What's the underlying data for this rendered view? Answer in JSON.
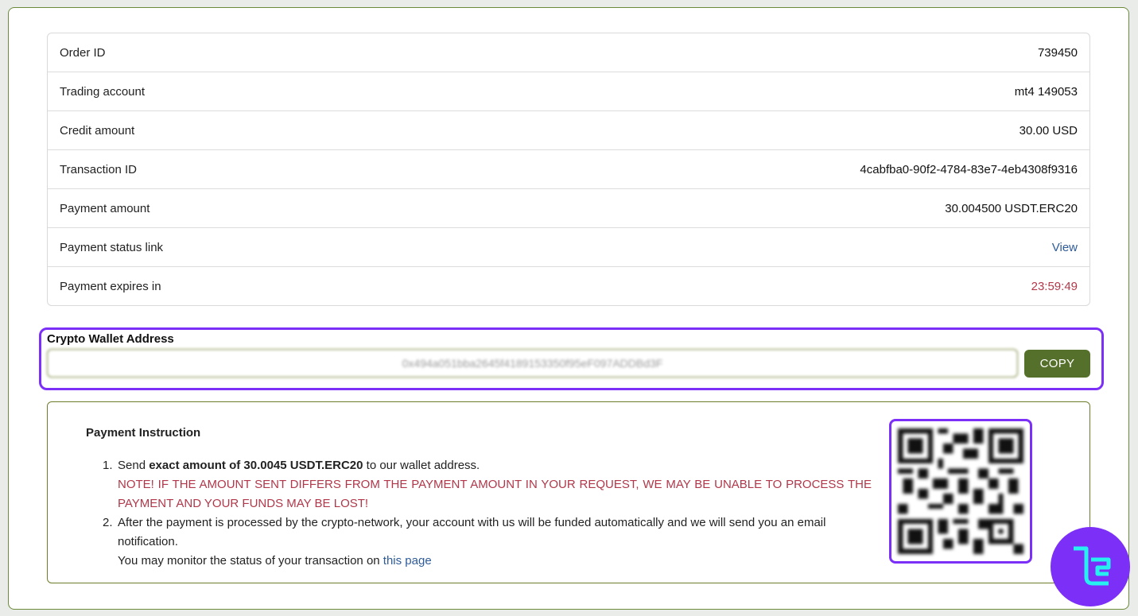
{
  "details": [
    {
      "label": "Order ID",
      "value": "739450"
    },
    {
      "label": "Trading account",
      "value": "mt4 149053"
    },
    {
      "label": "Credit amount",
      "value": "30.00 USD"
    },
    {
      "label": "Transaction ID",
      "value": "4cabfba0-90f2-4784-83e7-4eb4308f9316"
    },
    {
      "label": "Payment amount",
      "value": "30.004500 USDT.ERC20"
    },
    {
      "label": "Payment status link",
      "value": "View"
    },
    {
      "label": "Payment expires in",
      "value": "23:59:49"
    }
  ],
  "wallet": {
    "title": "Crypto Wallet Address",
    "address": "0x494a051bba2645f4189153350f95eF097ADDBd3F",
    "copy_label": "COPY"
  },
  "instruction": {
    "title": "Payment Instruction",
    "step1_prefix": "Send ",
    "step1_bold": "exact amount of 30.0045 USDT.ERC20",
    "step1_suffix": " to our wallet address.",
    "warning": "NOTE! IF THE AMOUNT SENT DIFFERS FROM THE PAYMENT AMOUNT IN YOUR REQUEST, WE MAY BE UNABLE TO PROCESS THE PAYMENT AND YOUR FUNDS MAY BE LOST!",
    "step2_text": "After the payment is processed by the crypto-network, your account with us will be funded automatically and we will send you an email notification.",
    "monitor_text": "You may monitor the status of your transaction on ",
    "monitor_link": "this page"
  },
  "colors": {
    "accent_purple": "#7b2ff7",
    "button_green": "#55702a",
    "warning_red": "#b0384a",
    "link_blue": "#2e5b9a"
  },
  "icons": {
    "qr": "qr-code-image",
    "logo": "tradingfinder-logo-icon"
  }
}
